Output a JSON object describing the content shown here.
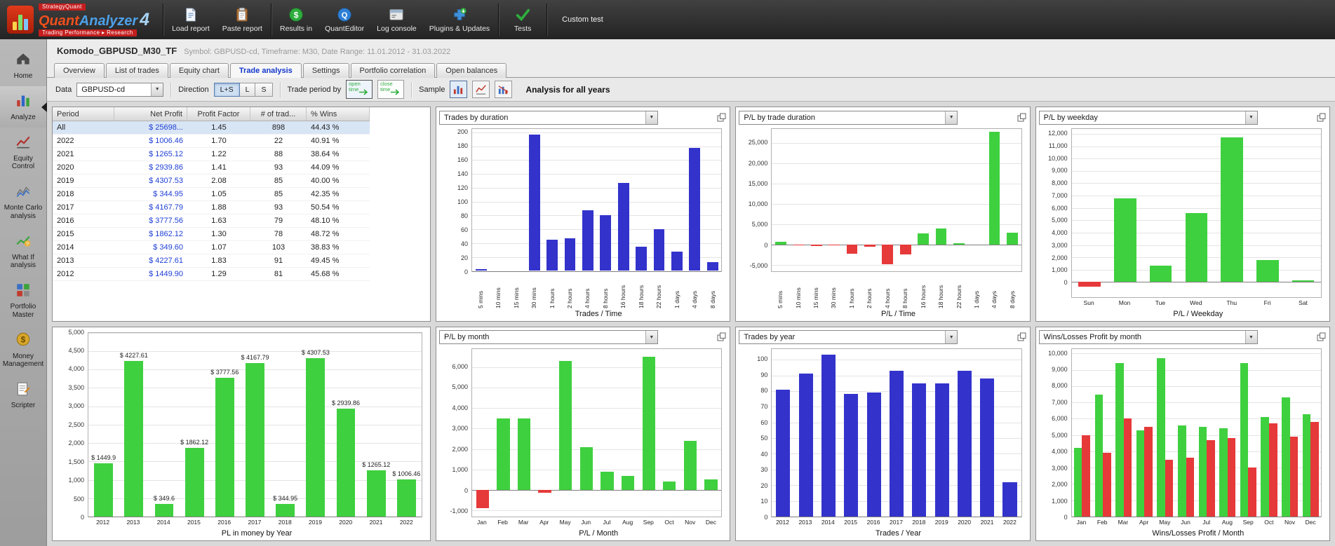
{
  "toolbar": {
    "logo": {
      "brand": "StrategyQuant",
      "product_quant": "Quant",
      "product_analyzer": "Analyzer",
      "version": "4",
      "tagline": "Trading Performance ▸ Research"
    },
    "buttons": [
      {
        "label": "Load report",
        "icon": "load-report"
      },
      {
        "label": "Paste report",
        "icon": "paste-report",
        "sep_after": true
      },
      {
        "label": "Results in",
        "icon": "results-in"
      },
      {
        "label": "QuantEditor",
        "icon": "quanteditor"
      },
      {
        "label": "Log console",
        "icon": "log-console"
      },
      {
        "label": "Plugins & Updates",
        "icon": "plugins-updates",
        "sep_after": true
      },
      {
        "label": "Tests",
        "icon": "tests",
        "sep_after": true
      }
    ],
    "custom_test_label": "Custom test"
  },
  "sidebar": {
    "items": [
      {
        "label": "Home",
        "icon": "home"
      },
      {
        "label": "Analyze",
        "icon": "analyze",
        "active": true
      },
      {
        "label": "Equity Control",
        "icon": "equity-control"
      },
      {
        "label": "Monte Carlo analysis",
        "icon": "monte-carlo"
      },
      {
        "label": "What If analysis",
        "icon": "what-if"
      },
      {
        "label": "Portfolio Master",
        "icon": "portfolio-master"
      },
      {
        "label": "Money Management",
        "icon": "money-management"
      },
      {
        "label": "Scripter",
        "icon": "scripter"
      }
    ]
  },
  "header": {
    "title": "Komodo_GBPUSD_M30_TF",
    "subtitle": "Symbol: GBPUSD-cd, Timeframe: M30, Date Range: 11.01.2012 - 31.03.2022"
  },
  "tabs": [
    {
      "label": "Overview"
    },
    {
      "label": "List of trades"
    },
    {
      "label": "Equity chart"
    },
    {
      "label": "Trade analysis",
      "active": true
    },
    {
      "label": "Settings"
    },
    {
      "label": "Portfolio correlation"
    },
    {
      "label": "Open balances"
    }
  ],
  "filter_bar": {
    "data_label": "Data",
    "data_value": "GBPUSD-cd",
    "direction_label": "Direction",
    "direction_options": [
      "L+S",
      "L",
      "S"
    ],
    "direction_selected": "L+S",
    "trade_period_label": "Trade period by",
    "open_time_label": "open time",
    "close_time_label": "close time",
    "sample_label": "Sample",
    "analysis_label": "Analysis for all years"
  },
  "table": {
    "columns": [
      "Period",
      "Net Profit",
      "Profit Factor",
      "# of trad...",
      "% Wins"
    ],
    "rows": [
      {
        "period": "All",
        "net_profit": "$ 25698...",
        "profit_factor": "1.45",
        "num_trades": "898",
        "pct_wins": "44.43 %",
        "selected": true
      },
      {
        "period": "2022",
        "net_profit": "$ 1006.46",
        "profit_factor": "1.70",
        "num_trades": "22",
        "pct_wins": "40.91 %"
      },
      {
        "period": "2021",
        "net_profit": "$ 1265.12",
        "profit_factor": "1.22",
        "num_trades": "88",
        "pct_wins": "38.64 %"
      },
      {
        "period": "2020",
        "net_profit": "$ 2939.86",
        "profit_factor": "1.41",
        "num_trades": "93",
        "pct_wins": "44.09 %"
      },
      {
        "period": "2019",
        "net_profit": "$ 4307.53",
        "profit_factor": "2.08",
        "num_trades": "85",
        "pct_wins": "40.00 %"
      },
      {
        "period": "2018",
        "net_profit": "$ 344.95",
        "profit_factor": "1.05",
        "num_trades": "85",
        "pct_wins": "42.35 %"
      },
      {
        "period": "2017",
        "net_profit": "$ 4167.79",
        "profit_factor": "1.88",
        "num_trades": "93",
        "pct_wins": "50.54 %"
      },
      {
        "period": "2016",
        "net_profit": "$ 3777.56",
        "profit_factor": "1.63",
        "num_trades": "79",
        "pct_wins": "48.10 %"
      },
      {
        "period": "2015",
        "net_profit": "$ 1862.12",
        "profit_factor": "1.30",
        "num_trades": "78",
        "pct_wins": "48.72 %"
      },
      {
        "period": "2014",
        "net_profit": "$ 349.60",
        "profit_factor": "1.07",
        "num_trades": "103",
        "pct_wins": "38.83 %"
      },
      {
        "period": "2013",
        "net_profit": "$ 4227.61",
        "profit_factor": "1.83",
        "num_trades": "91",
        "pct_wins": "49.45 %"
      },
      {
        "period": "2012",
        "net_profit": "$ 1449.90",
        "profit_factor": "1.29",
        "num_trades": "81",
        "pct_wins": "45.68 %"
      }
    ]
  },
  "colors": {
    "blue_bar": "#3333cc",
    "green_bar": "#3fd03f",
    "red_bar": "#e63939",
    "net_profit_text": "#1f3fd4",
    "active_tab_text": "#1337cc"
  },
  "chart_data": [
    {
      "id": "trades-by-duration",
      "dropdown_label": "Trades by duration",
      "type": "bar",
      "categories": [
        "5 mins",
        "10 mins",
        "15 mins",
        "30 mins",
        "1 hours",
        "2 hours",
        "4 hours",
        "8 hours",
        "16 hours",
        "18 hours",
        "22 hours",
        "1 days",
        "4 days",
        "8 days"
      ],
      "values": [
        3,
        0,
        0,
        197,
        45,
        47,
        88,
        80,
        127,
        35,
        60,
        28,
        178,
        13
      ],
      "color": "#3333cc",
      "ymin": 0,
      "ymax": 205,
      "ystep": 20,
      "tick_start": 0,
      "tick_end": 200,
      "rotate_labels": true,
      "grid": true,
      "xlabel": "Trades / Time"
    },
    {
      "id": "pl-by-trade-duration",
      "dropdown_label": "P/L by trade duration",
      "type": "bar",
      "categories": [
        "5 mins",
        "10 mins",
        "15 mins",
        "30 mins",
        "1 hours",
        "2 hours",
        "4 hours",
        "8 hours",
        "16 hours",
        "18 hours",
        "22 hours",
        "1 days",
        "4 days",
        "8 days"
      ],
      "values": [
        600,
        -150,
        -350,
        -200,
        -2300,
        -500,
        -4900,
        -2500,
        2700,
        3900,
        400,
        0,
        27800,
        2900
      ],
      "color": "#3fd03f",
      "neg_color": "#e63939",
      "ymin": -6500,
      "ymax": 28500,
      "ystep": 5000,
      "tick_start": -5000,
      "tick_end": 25000,
      "rotate_labels": true,
      "grid": true,
      "xlabel": "P/L / Time"
    },
    {
      "id": "pl-by-weekday",
      "dropdown_label": "P/L by weekday",
      "type": "bar",
      "categories": [
        "Sun",
        "Mon",
        "Tue",
        "Wed",
        "Thu",
        "Fri",
        "Sat"
      ],
      "values": [
        -350,
        6800,
        1300,
        5600,
        11700,
        1800,
        150
      ],
      "color": "#3fd03f",
      "neg_color": "#e63939",
      "ymin": -1200,
      "ymax": 12400,
      "ystep": 1000,
      "tick_start": 0,
      "tick_end": 12000,
      "rotate_labels": false,
      "grid": true,
      "xlabel": "P/L / Weekday"
    },
    {
      "id": "pl-money-by-year",
      "dropdown_label": null,
      "type": "bar",
      "categories": [
        "2012",
        "2013",
        "2014",
        "2015",
        "2016",
        "2017",
        "2018",
        "2019",
        "2020",
        "2021",
        "2022"
      ],
      "values": [
        1449.9,
        4227.61,
        349.6,
        1862.12,
        3777.56,
        4167.79,
        344.95,
        4307.53,
        2939.86,
        1265.12,
        1006.46
      ],
      "bar_labels": [
        "$ 1449.9",
        "$ 4227.61",
        "$ 349.6",
        "$ 1862.12",
        "$ 3777.56",
        "$ 4167.79",
        "$ 344.95",
        "$ 4307.53",
        "$ 2939.86",
        "$ 1265.12",
        "$ 1006.46"
      ],
      "color": "#3fd03f",
      "ymin": 0,
      "ymax": 5000,
      "ystep": 500,
      "tick_start": 0,
      "tick_end": 5000,
      "rotate_labels": false,
      "grid": true,
      "xlabel": "PL in money by Year"
    },
    {
      "id": "pl-by-month",
      "dropdown_label": "P/L by month",
      "type": "bar",
      "categories": [
        "Jan",
        "Feb",
        "Mar",
        "Apr",
        "May",
        "Jun",
        "Jul",
        "Aug",
        "Sep",
        "Oct",
        "Nov",
        "Dec"
      ],
      "values": [
        -900,
        3500,
        3500,
        -150,
        6300,
        2100,
        900,
        700,
        6500,
        400,
        2400,
        500
      ],
      "color": "#3fd03f",
      "neg_color": "#e63939",
      "ymin": -1300,
      "ymax": 6900,
      "ystep": 1000,
      "tick_start": -1000,
      "tick_end": 6000,
      "rotate_labels": false,
      "grid": true,
      "xlabel": "P/L / Month"
    },
    {
      "id": "trades-by-year",
      "dropdown_label": "Trades by year",
      "type": "bar",
      "categories": [
        "2012",
        "2013",
        "2014",
        "2015",
        "2016",
        "2017",
        "2018",
        "2019",
        "2020",
        "2021",
        "2022"
      ],
      "values": [
        81,
        91,
        103,
        78,
        79,
        93,
        85,
        85,
        93,
        88,
        22
      ],
      "color": "#3333cc",
      "ymin": 0,
      "ymax": 107,
      "ystep": 10,
      "tick_start": 0,
      "tick_end": 100,
      "rotate_labels": false,
      "grid": true,
      "xlabel": "Trades / Year"
    },
    {
      "id": "wins-losses-by-month",
      "dropdown_label": "Wins/Losses Profit by month",
      "type": "bar",
      "categories": [
        "Jan",
        "Feb",
        "Mar",
        "Apr",
        "May",
        "Jun",
        "Jul",
        "Aug",
        "Sep",
        "Oct",
        "Nov",
        "Dec"
      ],
      "series": [
        {
          "name": "Wins",
          "color": "#3fd03f",
          "values": [
            4200,
            7500,
            9400,
            5300,
            9700,
            5600,
            5500,
            5400,
            9400,
            6100,
            7300,
            6300
          ]
        },
        {
          "name": "Losses",
          "color": "#e63939",
          "values": [
            5000,
            3900,
            6000,
            5500,
            3500,
            3600,
            4700,
            4800,
            3000,
            5700,
            4900,
            5800
          ]
        }
      ],
      "ymin": 0,
      "ymax": 10300,
      "ystep": 1000,
      "tick_start": 0,
      "tick_end": 10000,
      "rotate_labels": false,
      "grid": true,
      "xlabel": "Wins/Losses Profit / Month"
    }
  ]
}
